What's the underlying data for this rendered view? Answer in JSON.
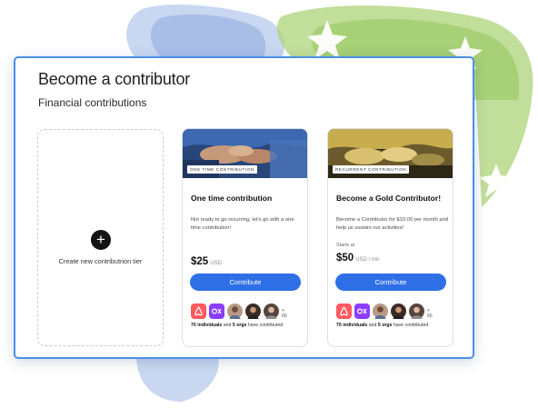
{
  "page": {
    "title": "Become a contributor",
    "subtitle": "Financial contributions"
  },
  "create_tier": {
    "icon": "plus-icon",
    "label": "Create new contributrion tier"
  },
  "tiers": [
    {
      "tag": "ONE TIME CONTRIBUTION",
      "title": "One time contribution",
      "description": "Not ready to go recurring, let's go with a one time contribution!",
      "starts_at": "",
      "price": "$25",
      "price_unit": "USD",
      "button": "Contribute",
      "avatars": [
        "airbnb-logo",
        "org-logo",
        "user-avatar",
        "user-avatar",
        "user-avatar"
      ],
      "more_count": "+ 66",
      "individuals": "70 individuals",
      "and": "and",
      "orgs": "5 orgs",
      "suffix": "have contributed"
    },
    {
      "tag": "RECURRENT CONTRIBUTION",
      "title": "Become a Gold Contributor!",
      "description": "Become a Contributor for $10.00 per month and help us sustain our activities!",
      "starts_at": "Starts at",
      "price": "$50",
      "price_unit": "USD / mo",
      "button": "Contribute",
      "avatars": [
        "airbnb-logo",
        "org-logo",
        "user-avatar",
        "user-avatar",
        "user-avatar"
      ],
      "more_count": "+ 66",
      "individuals": "70 individuals",
      "and": "and",
      "orgs": "5 orgs",
      "suffix": "have contributed"
    }
  ],
  "colors": {
    "accent": "#2e6fe6",
    "panel_border": "#4b90e8",
    "airbnb": "#ff5a5f",
    "org_purple": "#8b3dff"
  }
}
